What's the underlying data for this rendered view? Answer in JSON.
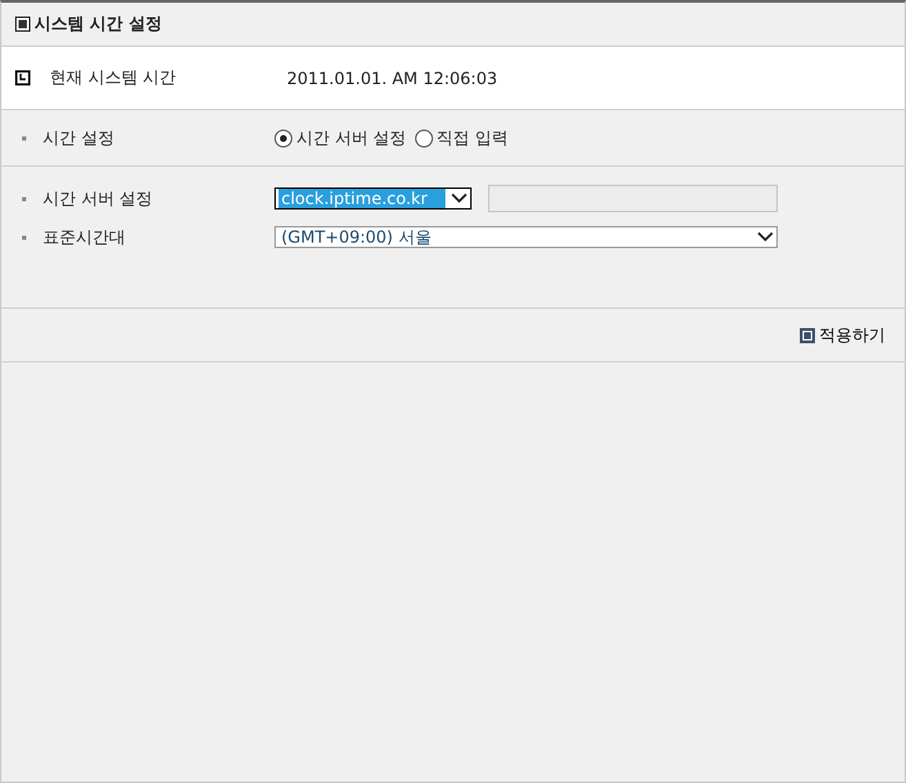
{
  "title": "시스템 시간 설정",
  "current_time": {
    "label": "현재 시스템 시간",
    "value": "2011.01.01. AM 12:06:03"
  },
  "time_setting": {
    "label": "시간 설정",
    "options": [
      {
        "label": "시간 서버 설정",
        "selected": true
      },
      {
        "label": "직접 입력",
        "selected": false
      }
    ]
  },
  "time_server": {
    "label": "시간 서버 설정",
    "value": "clock.iptime.co.kr",
    "focused": true,
    "extra_field_disabled": true
  },
  "timezone": {
    "label": "표준시간대",
    "value": "(GMT+09:00) 서울"
  },
  "apply_button": "적용하기"
}
